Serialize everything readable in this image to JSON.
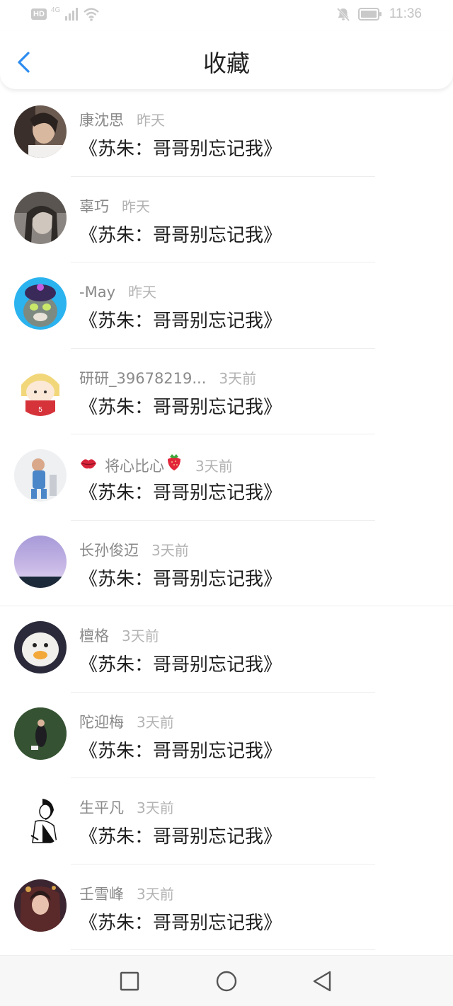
{
  "status_bar": {
    "hd_badge": "HD",
    "network": "4G",
    "time": "11:36",
    "icons": [
      "hd-icon",
      "signal-icon",
      "wifi-icon",
      "mute-icon",
      "battery-icon"
    ]
  },
  "header": {
    "title": "收藏",
    "back_icon": "chevron-left-icon",
    "accent_color": "#2d8cf0"
  },
  "items": [
    {
      "name": "康沈思",
      "time": "昨天",
      "book": "《苏朱：哥哥别忘记我》"
    },
    {
      "name": "辜巧",
      "time": "昨天",
      "book": "《苏朱：哥哥别忘记我》"
    },
    {
      "name": "-May",
      "time": "昨天",
      "book": "《苏朱：哥哥别忘记我》"
    },
    {
      "name": "研研_39678219...",
      "time": "3天前",
      "book": "《苏朱：哥哥别忘记我》"
    },
    {
      "name": "将心比心",
      "time": "3天前",
      "book": "《苏朱：哥哥别忘记我》"
    },
    {
      "name": "长孙俊迈",
      "time": "3天前",
      "book": "《苏朱：哥哥别忘记我》"
    },
    {
      "name": "檀格",
      "time": "3天前",
      "book": "《苏朱：哥哥别忘记我》"
    },
    {
      "name": "陀迎梅",
      "time": "3天前",
      "book": "《苏朱：哥哥别忘记我》"
    },
    {
      "name": "生平凡",
      "time": "3天前",
      "book": "《苏朱：哥哥别忘记我》"
    },
    {
      "name": "壬雪峰",
      "time": "3天前",
      "book": "《苏朱：哥哥别忘记我》"
    }
  ],
  "nav_bar": {
    "icons": [
      "recent-apps-icon",
      "home-icon",
      "back-triangle-icon"
    ]
  }
}
